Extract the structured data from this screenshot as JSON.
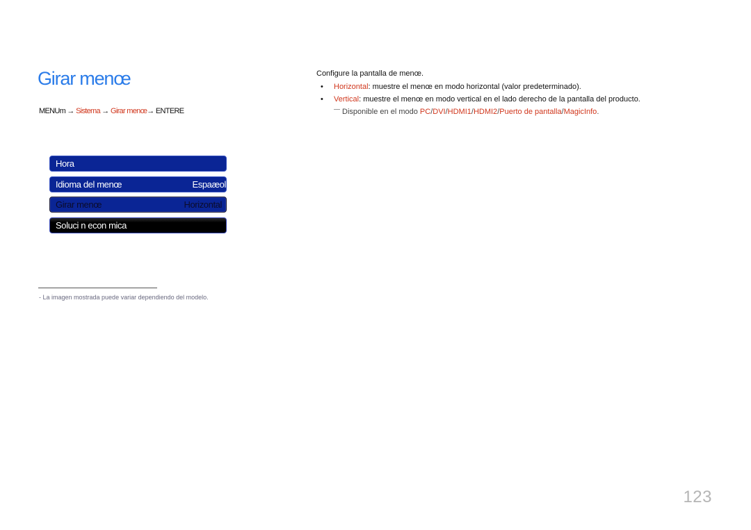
{
  "page": {
    "title": "Girar menœ",
    "menu_path": {
      "start": "MENUm",
      "arrow": "→",
      "step1": "Sistema",
      "step2": "Girar menœ",
      "end": "ENTERE"
    },
    "menu_panel": {
      "items": [
        {
          "label": "Hora",
          "value": ""
        },
        {
          "label": "Idioma del menœ",
          "value": "Espaæol"
        },
        {
          "label": "Girar menœ",
          "value": "Horizontal"
        },
        {
          "label": "Soluci n econ mica",
          "value": ""
        }
      ]
    },
    "description": {
      "intro": "Configure la pantalla de menœ.",
      "bullet_symbol": "•",
      "options": [
        {
          "name": "Horizontal",
          "text": ": muestre el menœ en modo horizontal (valor predeterminado)."
        },
        {
          "name": "Vertical",
          "text": ": muestre el menœ en modo vertical en el lado derecho de la pantalla del producto."
        }
      ],
      "note": {
        "prefix": "Disponible en el modo ",
        "modes": [
          "PC",
          "DVI",
          "HDMI1",
          "HDMI2",
          "Puerto de pantalla",
          "MagicInfo"
        ],
        "sep": "/",
        "suffix": "."
      }
    },
    "footnote": "-   La imagen mostrada puede variar dependiendo del modelo.",
    "page_number": "123"
  },
  "colors": {
    "title": "#2b7ce9",
    "accent_red": "#d0361c",
    "menu_blue": "#0a2595"
  }
}
